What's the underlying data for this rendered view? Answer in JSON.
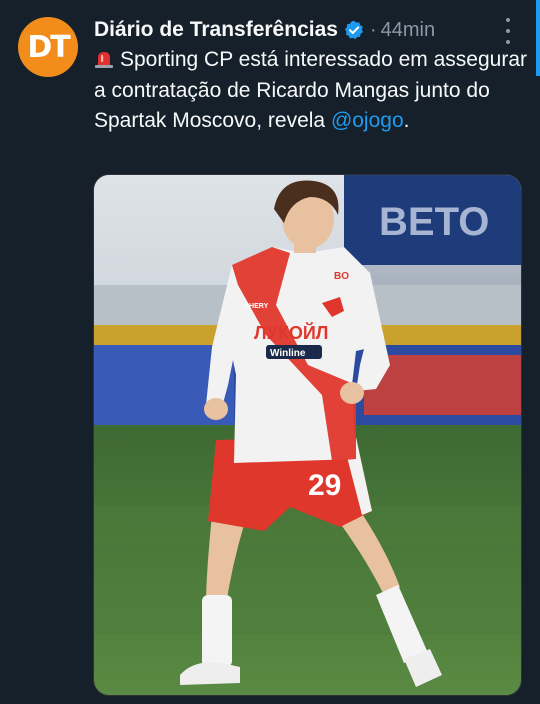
{
  "tweet": {
    "author": {
      "name": "Diário de Transferências",
      "avatar_initials": "DT",
      "verified": true,
      "avatar_color": "#f28c1b"
    },
    "separator": "·",
    "time": "44min",
    "more_icon": "more-horizontal-icon",
    "text_before_mention": "Sporting CP está interessado em assegurar a contratação de Ricardo Mangas junto do Spartak Moscovo, revela ",
    "mention": "@ojogo",
    "text_after_mention": ".",
    "siren_icon": "rotating-light-emoji",
    "media": {
      "type": "photo",
      "shirt_sponsor": "ЛУКОЙЛ",
      "secondary_sponsor": "Winline",
      "shirt_number": "29",
      "sleeve_text": "BO",
      "collar_brand": "CHERY",
      "board_text": "BETO"
    }
  },
  "colors": {
    "background": "#15202b",
    "accent": "#1d9bf0",
    "secondary_text": "#8b98a5",
    "kit_red": "#e0372c",
    "kit_white": "#f2f2f2",
    "pitch_green": "#4f7a3a"
  }
}
